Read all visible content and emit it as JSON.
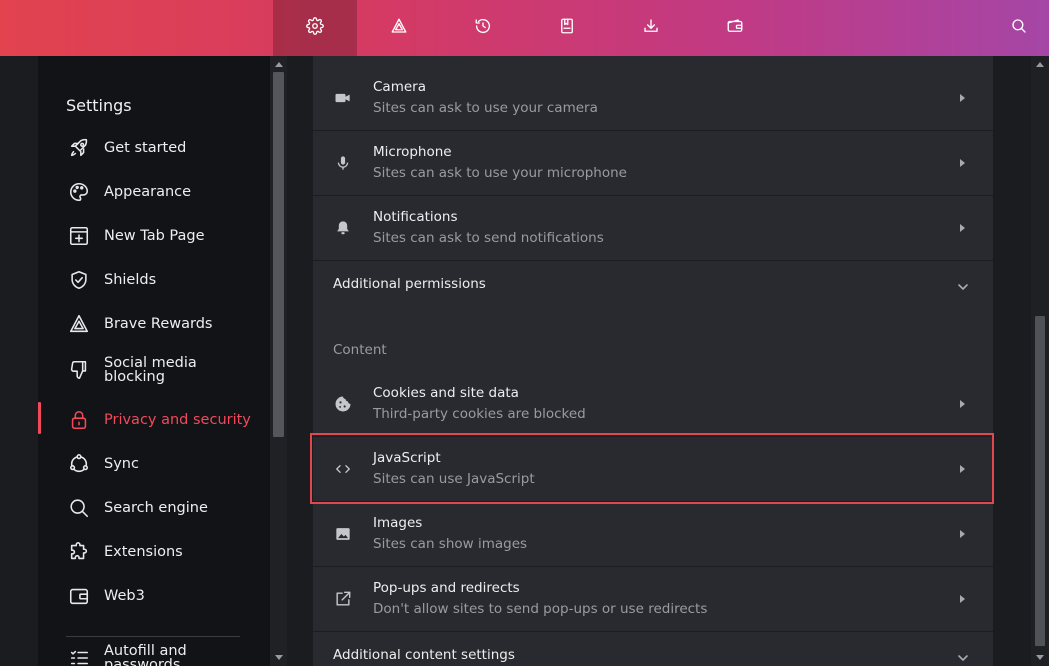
{
  "toolbar": {
    "buttons": [
      {
        "icon": "gear-icon",
        "active": true
      },
      {
        "icon": "brave-rewards-icon",
        "active": false
      },
      {
        "icon": "history-icon",
        "active": false
      },
      {
        "icon": "bookmarks-icon",
        "active": false
      },
      {
        "icon": "download-icon",
        "active": false
      },
      {
        "icon": "wallet-icon",
        "active": false
      }
    ],
    "search_icon": "search-icon",
    "gradient": [
      "#e2434f",
      "#a546a6"
    ]
  },
  "sidebar": {
    "title": "Settings",
    "items": [
      {
        "label": "Get started",
        "icon": "rocket-icon"
      },
      {
        "label": "Appearance",
        "icon": "palette-icon"
      },
      {
        "label": "New Tab Page",
        "icon": "new-tab-icon"
      },
      {
        "label": "Shields",
        "icon": "shield-icon"
      },
      {
        "label": "Brave Rewards",
        "icon": "brave-rewards-icon"
      },
      {
        "label": "Social media blocking",
        "icon": "thumbs-down-icon"
      },
      {
        "label": "Privacy and security",
        "icon": "lock-icon",
        "active": true
      },
      {
        "label": "Sync",
        "icon": "sync-icon"
      },
      {
        "label": "Search engine",
        "icon": "search-icon"
      },
      {
        "label": "Extensions",
        "icon": "puzzle-icon"
      },
      {
        "label": "Web3",
        "icon": "wallet-icon"
      },
      {
        "label": "Autofill and passwords",
        "icon": "list-icon"
      }
    ],
    "active_color": "#f1495a"
  },
  "main": {
    "permissions": [
      {
        "title": "Camera",
        "subtitle": "Sites can ask to use your camera",
        "icon": "camera-icon"
      },
      {
        "title": "Microphone",
        "subtitle": "Sites can ask to use your microphone",
        "icon": "microphone-icon"
      },
      {
        "title": "Notifications",
        "subtitle": "Sites can ask to send notifications",
        "icon": "bell-icon"
      }
    ],
    "additional_permissions": "Additional permissions",
    "content_label": "Content",
    "content": [
      {
        "title": "Cookies and site data",
        "subtitle": "Third-party cookies are blocked",
        "icon": "cookie-icon"
      },
      {
        "title": "JavaScript",
        "subtitle": "Sites can use JavaScript",
        "icon": "code-icon",
        "highlighted": true
      },
      {
        "title": "Images",
        "subtitle": "Sites can show images",
        "icon": "image-icon"
      },
      {
        "title": "Pop-ups and redirects",
        "subtitle": "Don't allow sites to send pop-ups or use redirects",
        "icon": "external-link-icon"
      }
    ],
    "additional_content_settings": "Additional content settings",
    "highlight_color": "#e0474f"
  }
}
